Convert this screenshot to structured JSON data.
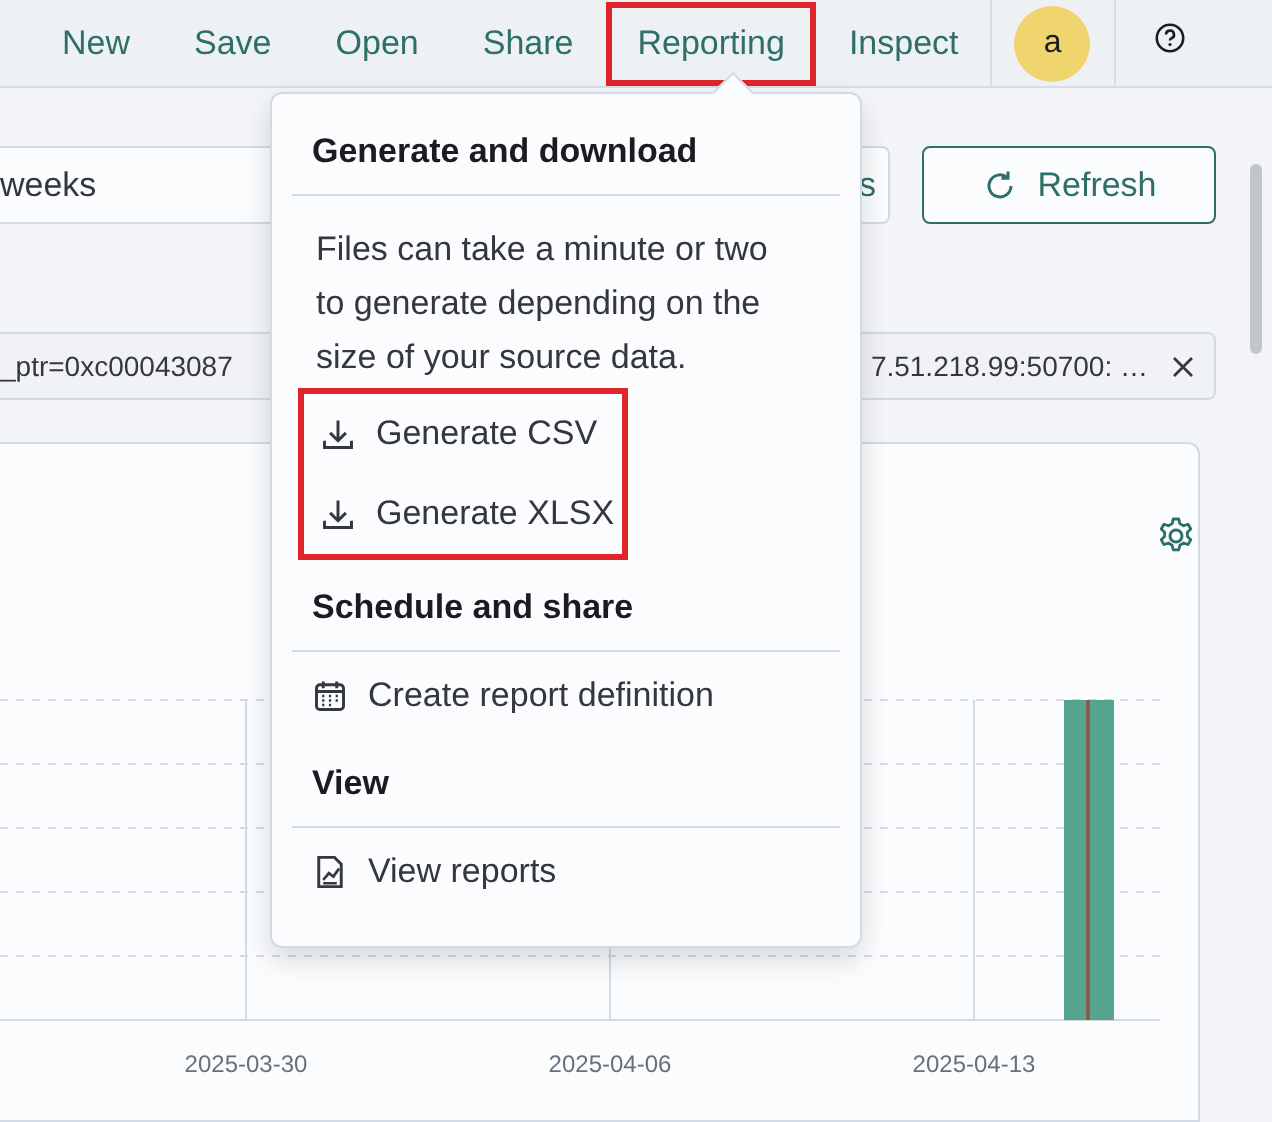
{
  "nav": {
    "items": [
      {
        "label": "New",
        "highlighted": false
      },
      {
        "label": "Save",
        "highlighted": false
      },
      {
        "label": "Open",
        "highlighted": false
      },
      {
        "label": "Share",
        "highlighted": false
      },
      {
        "label": "Reporting",
        "highlighted": true
      },
      {
        "label": "Inspect",
        "highlighted": false
      }
    ],
    "avatar": "a"
  },
  "query": {
    "value": "weeks",
    "partial_button": "s",
    "refresh": "Refresh"
  },
  "filter": {
    "left": "_ptr=0xc00043087",
    "right": "7.51.218.99:50700: …"
  },
  "chart": {
    "x_axis_labels": [
      "2025-03-30",
      "2025-04-06",
      "2025-04-13"
    ]
  },
  "report_menu": {
    "sections": [
      {
        "title": "Generate and download",
        "description": "Files can take a minute or two to generate depending on the size of your source data.",
        "highlighted": true,
        "items": [
          {
            "label": "Generate CSV",
            "kind": "download"
          },
          {
            "label": "Generate XLSX",
            "kind": "download"
          }
        ]
      },
      {
        "title": "Schedule and share",
        "highlighted": false,
        "items": [
          {
            "label": "Create report definition",
            "kind": "calendar"
          }
        ]
      },
      {
        "title": "View",
        "highlighted": false,
        "items": [
          {
            "label": "View reports",
            "kind": "report"
          }
        ]
      }
    ]
  }
}
